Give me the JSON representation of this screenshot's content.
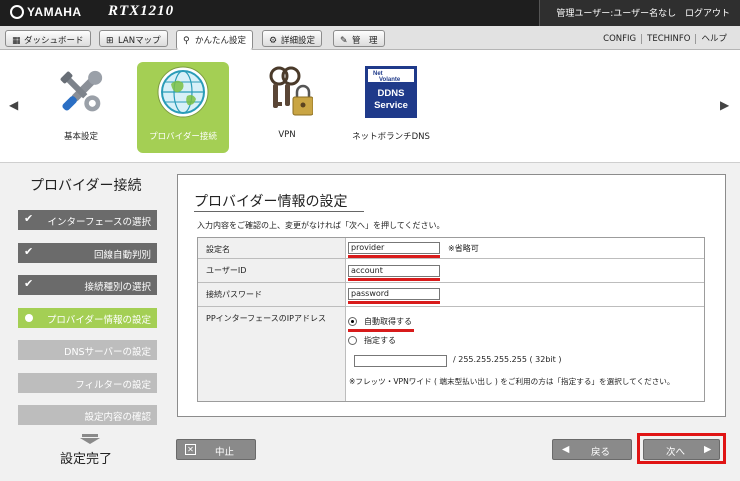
{
  "header": {
    "brand": "YAMAHA",
    "model": "RTX1210",
    "user_info": "管理ユーザー:ユーザー名なし",
    "logout": "ログアウト"
  },
  "tabs": [
    {
      "label": "ダッシュボード",
      "icon": "dashboard-icon"
    },
    {
      "label": "LANマップ",
      "icon": "lanmap-icon"
    },
    {
      "label": "かんたん設定",
      "icon": "wizard-icon",
      "active": true
    },
    {
      "label": "詳細設定",
      "icon": "gear-icon"
    },
    {
      "label": "管　理",
      "icon": "wrench-icon"
    }
  ],
  "top_links": [
    "CONFIG",
    "TECHINFO",
    "ヘルプ"
  ],
  "wizards": [
    {
      "label": "基本設定",
      "icon": "tools-icon"
    },
    {
      "label": "プロバイダー接続",
      "icon": "globe-icon",
      "selected": true
    },
    {
      "label": "VPN",
      "icon": "keys-lock-icon"
    },
    {
      "label": "ネットボランチDNS",
      "icon": "ddns-icon",
      "icon_text": [
        "Net",
        "Volante",
        "DDNS",
        "Service"
      ]
    }
  ],
  "steps": {
    "title": "プロバイダー接続",
    "items": [
      {
        "label": "インターフェースの選択",
        "state": "done"
      },
      {
        "label": "回線自動判別",
        "state": "done"
      },
      {
        "label": "接続種別の選択",
        "state": "done"
      },
      {
        "label": "プロバイダー情報の設定",
        "state": "current"
      },
      {
        "label": "DNSサーバーの設定",
        "state": "todo"
      },
      {
        "label": "フィルターの設定",
        "state": "todo"
      },
      {
        "label": "設定内容の確認",
        "state": "todo"
      }
    ],
    "done_label": "設定完了"
  },
  "panel": {
    "title": "プロバイダー情報の設定",
    "instruction": "入力内容をご確認の上、変更がなければ「次へ」を押してください。",
    "setting_name": {
      "label": "設定名",
      "value": "provider",
      "note": "※省略可"
    },
    "user_id": {
      "label": "ユーザーID",
      "value": "account"
    },
    "password": {
      "label": "接続パスワード",
      "value": "password"
    },
    "pp_ip": {
      "label": "PPインターフェースのIPアドレス",
      "option_auto": "自動取得する",
      "option_manual": "指定する",
      "address_value": "",
      "mask_text": "/ 255.255.255.255 ( 32bit )",
      "note": "※フレッツ・VPNワイド ( 端末型払い出し ) をご利用の方は「指定する」を選択してください。"
    }
  },
  "buttons": {
    "cancel": "中止",
    "back": "戻る",
    "next": "次へ"
  },
  "colors": {
    "accent_green": "#a4cf54",
    "highlight_red": "#e01414",
    "header_bg": "#1e1e1e"
  }
}
